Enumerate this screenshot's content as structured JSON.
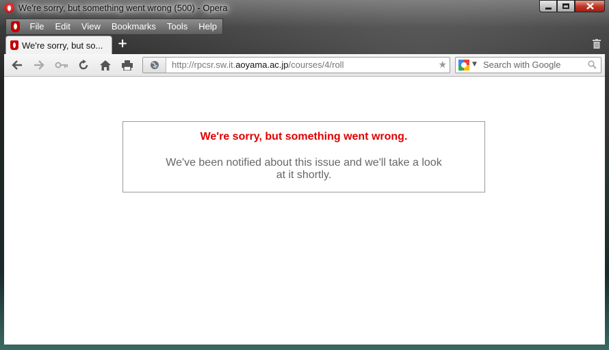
{
  "window": {
    "title": "We're sorry, but something went wrong (500) - Opera"
  },
  "menubar": {
    "items": [
      "File",
      "Edit",
      "View",
      "Bookmarks",
      "Tools",
      "Help"
    ]
  },
  "tab": {
    "label": "We're sorry, but so..."
  },
  "toolbar": {
    "address_prefix": "http://rpcsr.sw.it.",
    "address_host": "aoyama.ac.jp",
    "address_path": "/courses/4/roll",
    "search_placeholder": "Search with Google"
  },
  "content": {
    "error_title": "We're sorry, but something went wrong.",
    "error_body": "We've been notified about this issue and we'll take a look at it shortly."
  },
  "colors": {
    "error_title": "#e00000",
    "brand": "#c40000"
  }
}
